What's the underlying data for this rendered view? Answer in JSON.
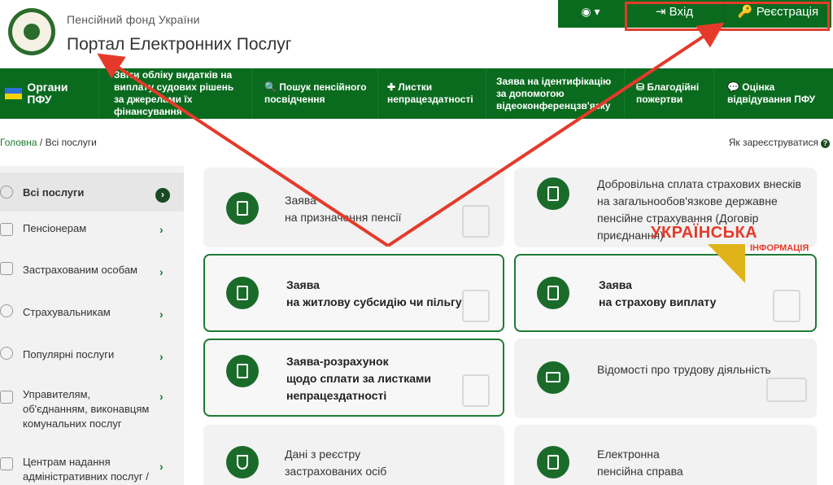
{
  "header": {
    "org_name": "Пенсійний фонд України",
    "portal_title": "Портал Електронних Послуг",
    "eye_label": "◉ ▾",
    "login_label": "⇥ Вхід",
    "register_label": "🔑 Реєстрація"
  },
  "nav": [
    {
      "label": "Органи ПФУ"
    },
    {
      "label": "Звіти обліку видатків на виплату судових рішень за джерелами їх фінансування"
    },
    {
      "label": "🔍 Пошук пенсійного посвідчення"
    },
    {
      "label": "✚ Листки непрацездатності"
    },
    {
      "label": "Заява на ідентифікацію за допомогою відеоконференцзв'язку"
    },
    {
      "label": "⛁ Благодійні пожертви"
    },
    {
      "label": "💬 Оцінка відвідування ПФУ"
    }
  ],
  "breadcrumb": {
    "home": "Головна",
    "sep": " / ",
    "current": "Всі послуги"
  },
  "how_register": "Як зареєструватися",
  "sidebar": [
    {
      "label": "Всі послуги"
    },
    {
      "label": "Пенсіонерам"
    },
    {
      "label": "Застрахованим особам"
    },
    {
      "label": "Страхувальникам"
    },
    {
      "label": "Популярні послуги"
    },
    {
      "label": "Управителям, об'єднанням, виконавцям комунальних послуг"
    },
    {
      "label": "Центрам надання адміністративних послуг /"
    }
  ],
  "cards": [
    {
      "lines": [
        "Заява",
        "на призначення пенсії"
      ]
    },
    {
      "lines": [
        "Добровільна сплата страхових внесків",
        "на загальнообов'язкове державне",
        "пенсійне страхування (Договір",
        "приєднання)"
      ]
    },
    {
      "lines": [
        "Заява",
        "на житлову субсидію чи пільгу"
      ]
    },
    {
      "lines": [
        "Заява",
        "на страхову виплату"
      ]
    },
    {
      "lines": [
        "Заява-розрахунок",
        "щодо сплати за листками",
        "непрацездатності"
      ]
    },
    {
      "lines": [
        "Відомості про трудову діяльність"
      ]
    },
    {
      "lines": [
        "Дані з реєстру",
        "застрахованих осіб"
      ]
    },
    {
      "lines": [
        "Електронна",
        "пенсійна справа"
      ]
    }
  ],
  "watermark": {
    "title": "УКРАЇНСЬКА",
    "subtitle": "ІНФОРМАЦІЯ"
  },
  "colors": {
    "primary_green": "#0a6b1f",
    "annotation_red": "#e53a2a"
  }
}
